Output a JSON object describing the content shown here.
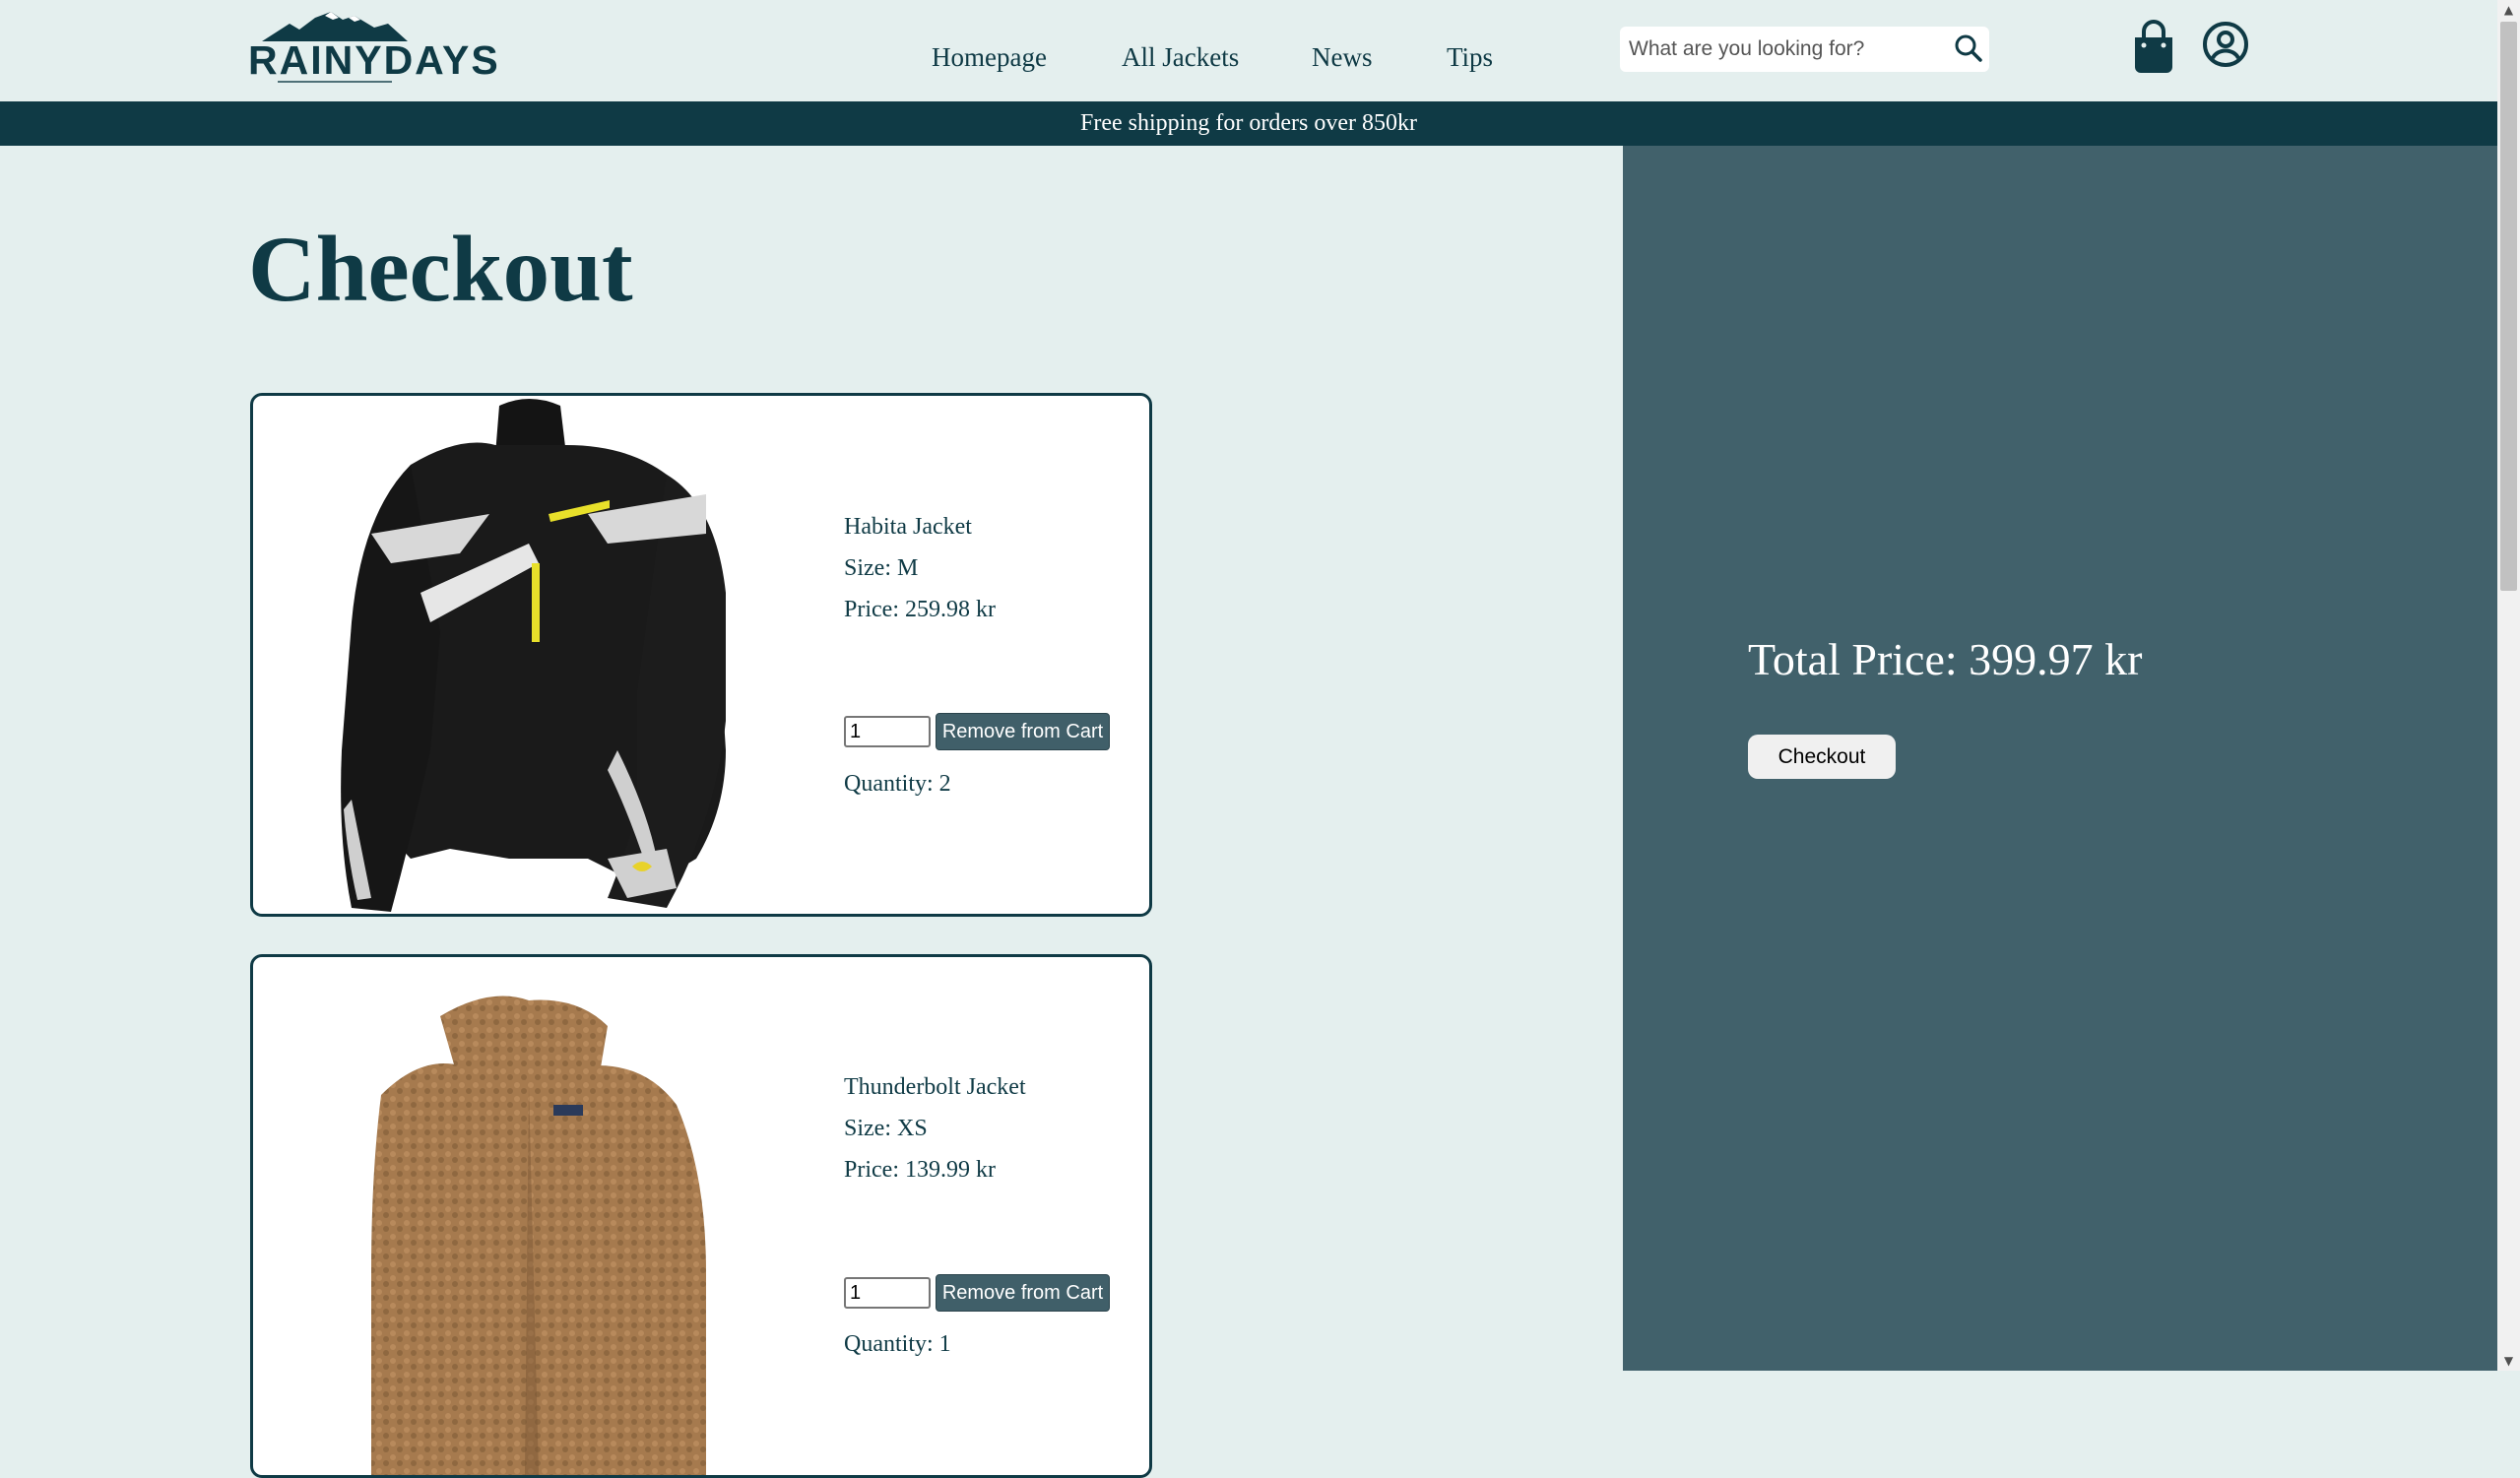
{
  "header": {
    "logo_text": "RAINYDAYS",
    "nav": [
      {
        "label": "Homepage"
      },
      {
        "label": "All Jackets"
      },
      {
        "label": "News"
      },
      {
        "label": "Tips"
      }
    ],
    "search": {
      "placeholder": "What are you looking for?",
      "icon": "search-icon"
    },
    "cart_icon": "shopping-bag-icon",
    "user_icon": "user-circle-icon"
  },
  "banner": {
    "text": "Free shipping for orders over 850kr"
  },
  "main": {
    "title": "Checkout"
  },
  "cart_items": [
    {
      "name": "Habita Jacket",
      "size": "Size: M",
      "price": "Price: 259.98 kr",
      "quantity_input": "1",
      "remove_label": "Remove from Cart",
      "quantity": "Quantity: 2",
      "image": "black-scott-jacket"
    },
    {
      "name": "Thunderbolt Jacket",
      "size": "Size: XS",
      "price": "Price: 139.99 kr",
      "quantity_input": "1",
      "remove_label": "Remove from Cart",
      "quantity": "Quantity: 1",
      "image": "brown-fleece-jacket"
    }
  ],
  "summary": {
    "total": "Total Price: 399.97 kr",
    "checkout_label": "Checkout"
  },
  "colors": {
    "background": "#e4efee",
    "primary": "#0f3a45",
    "panel": "#41616b",
    "button": "#405f69"
  }
}
